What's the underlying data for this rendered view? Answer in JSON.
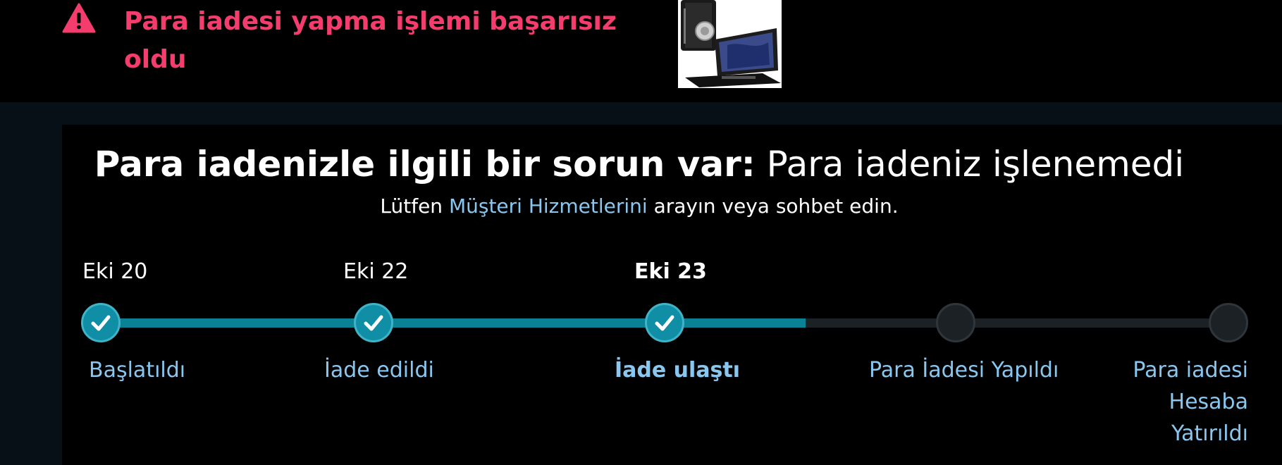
{
  "alert": {
    "icon": "warning-triangle-icon",
    "color": "#f43d6c",
    "line1": "Para iadesi yapma işlemi başarısız",
    "line2": "oldu"
  },
  "product": {
    "image": "tablet-case-product-image"
  },
  "status": {
    "headline_bold": "Para iadenizle ilgili bir sorun var:",
    "headline_rest": " Para iadeniz işlenemedi",
    "sub_before": "Lütfen ",
    "sub_link": "Müşteri Hizmetlerini",
    "sub_after": " arayın veya sohbet edin."
  },
  "timeline": {
    "accent": "#0a8195",
    "steps": [
      {
        "date": "Eki 20",
        "label": "Başlatıldı",
        "done": true
      },
      {
        "date": "Eki 22",
        "label": "İade edildi",
        "done": true
      },
      {
        "date": "Eki 23",
        "label": "İade ulaştı",
        "done": true,
        "current": true
      },
      {
        "date": "",
        "label": "Para İadesi Yapıldı",
        "done": false
      },
      {
        "date": "",
        "label_lines": [
          "Para iadesi",
          "Hesaba",
          "Yatırıldı"
        ],
        "done": false
      }
    ]
  }
}
